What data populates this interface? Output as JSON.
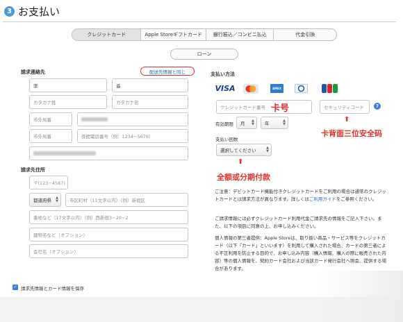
{
  "header": {
    "step": "3",
    "title": "お支払い"
  },
  "tabs": [
    {
      "label": "クレジットカード",
      "active": true
    },
    {
      "label": "Apple Storeギフトカード",
      "active": false
    },
    {
      "label": "銀行振込／コンビニ払込",
      "active": false
    },
    {
      "label": "代金引換",
      "active": false
    }
  ],
  "loan_button": "ローン",
  "billing": {
    "section_title": "請求連絡先",
    "same_as_shipping": "配送先情報と同じ",
    "last_name": "李",
    "first_name": "遥",
    "kana_last_placeholder": "カタカナ姓",
    "kana_first_placeholder": "カタカナ名",
    "area_code_placeholder": "市外局番",
    "phone_placeholder": "夜間電話番号（例：1234−5678）"
  },
  "address": {
    "section_title": "請求先住所",
    "postal": "〒(123−4567)",
    "prefecture": "都道府県",
    "city_placeholder": "市区町村（11文字以内）（例）新宿区",
    "street_placeholder": "番地など（17文字以内）（例）西新宿3−20−2",
    "building_placeholder": "建物名など（オプション）",
    "company_placeholder": "会社名（オプション）"
  },
  "payment": {
    "section_title": "支払い方法",
    "card_brands": [
      "VISA",
      "MasterCard",
      "AMEX",
      "Diners Club",
      "JCB"
    ],
    "card_number_placeholder": "クレジットカード番号",
    "security_placeholder": "セキュリティコード",
    "expiry_label": "有効期限",
    "month": "月",
    "year": "年",
    "installments_label": "支払い回数",
    "installments_placeholder": "選択してください",
    "help_glyph": "?"
  },
  "annotations": {
    "card_number": "卡号",
    "security_code": "卡背面三位安全码",
    "installments": "全额或分期付款"
  },
  "notices": {
    "n1_pre": "ご注意：デビットカード機能付きクレジットカードをご利用の場合は通常のクレジットカードとは請求方法が異なります。詳しくは",
    "n1_link": "ご利用ガイド",
    "n1_post": "をご参照ください。",
    "n2": "ご請求情報には必ずクレジットカード利用代金ご請求先の情報をご記入下さい。また、以下の項目に同意の上、お申し込みください。",
    "n3": "個人情報の第三者提供：Apple Storeは、取り扱い商品・サービス等をクレジットカード（以下「カード」といいます）を利用して購入された場合、カードの第三者による不正利用を防止する目的で、お申し込み内容（購入情報、購入の際に販売された内容）等の個人情報を、契約カード会社および当該カード発行会社へ照会、提供する場合があります。"
  },
  "save_label": "請求先情報とカード情報を保存",
  "colors": {
    "accent": "#3b82d6",
    "annotation": "#e4322b",
    "link": "#2a68b0"
  }
}
